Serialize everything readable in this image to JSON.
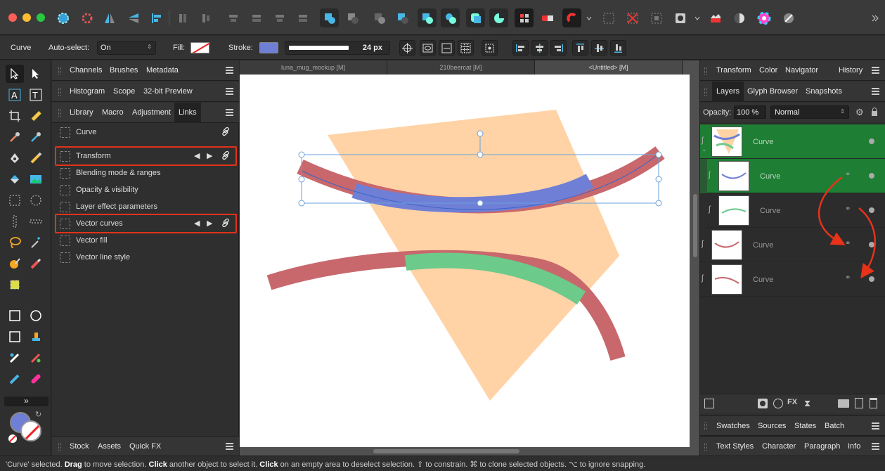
{
  "window": {
    "traffic_lights": [
      "#ff5f57",
      "#febc2e",
      "#28c840"
    ]
  },
  "context_bar": {
    "tool_name": "Curve",
    "auto_select_label": "Auto-select:",
    "auto_select_value": "On",
    "fill_label": "Fill:",
    "stroke_label": "Stroke:",
    "stroke_color": "#6f7fd6",
    "stroke_width": "24 px"
  },
  "left_panels": {
    "group1_tabs": [
      "Channels",
      "Brushes",
      "Metadata"
    ],
    "group2_tabs": [
      "Histogram",
      "Scope",
      "32-bit Preview"
    ],
    "group3_tabs": [
      "Library",
      "Macro",
      "Adjustment",
      "Links"
    ],
    "group3_active": "Links",
    "links": [
      {
        "label": "Curve",
        "highlight": false,
        "arrows": false,
        "link": true
      },
      {
        "label": "Transform",
        "highlight": true,
        "arrows": true,
        "link": true
      },
      {
        "label": "Blending mode & ranges",
        "highlight": false,
        "arrows": false,
        "link": false
      },
      {
        "label": "Opacity & visibility",
        "highlight": false,
        "arrows": false,
        "link": false
      },
      {
        "label": "Layer effect parameters",
        "highlight": false,
        "arrows": false,
        "link": false
      },
      {
        "label": "Vector curves",
        "highlight": true,
        "arrows": true,
        "link": true
      },
      {
        "label": "Vector fill",
        "highlight": false,
        "arrows": false,
        "link": false
      },
      {
        "label": "Vector line style",
        "highlight": false,
        "arrows": false,
        "link": false
      }
    ],
    "bottom_tabs": [
      "Stock",
      "Assets",
      "Quick FX"
    ]
  },
  "documents": {
    "tabs": [
      "luna_mug_mockup [M]",
      "210beercat [M]",
      "<Untitled> [M]"
    ],
    "active": "<Untitled> [M]"
  },
  "right_panels": {
    "top_tabs": [
      "Transform",
      "Color",
      "Navigator",
      "History"
    ],
    "layers_tabs": [
      "Layers",
      "Glyph Browser",
      "Snapshots"
    ],
    "opacity_label": "Opacity:",
    "opacity_value": "100 %",
    "blend_mode": "Normal",
    "layers": [
      {
        "name": "Curve",
        "selected": true,
        "child": false
      },
      {
        "name": "Curve",
        "selected": true,
        "child": true
      },
      {
        "name": "Curve",
        "selected": false,
        "child": true
      },
      {
        "name": "Curve",
        "selected": false,
        "child": false
      },
      {
        "name": "Curve",
        "selected": false,
        "child": false
      }
    ],
    "bottom_tabs_1": [
      "Swatches",
      "Sources",
      "States",
      "Batch"
    ],
    "bottom_tabs_2": [
      "Text Styles",
      "Character",
      "Paragraph",
      "Info"
    ]
  },
  "status": {
    "parts": [
      {
        "t": "'Curve' selected. ",
        "b": false
      },
      {
        "t": "Drag",
        "b": true
      },
      {
        "t": " to move selection. ",
        "b": false
      },
      {
        "t": "Click",
        "b": true
      },
      {
        "t": " another object to select it. ",
        "b": false
      },
      {
        "t": "Click",
        "b": true
      },
      {
        "t": " on an empty area to deselect selection. ⇧ to constrain. ⌘ to clone selected objects. ⌥ to ignore snapping.",
        "b": false
      }
    ]
  },
  "colors": {
    "accent_green": "#1e7e34",
    "canvas_shape": "#ffd3a6",
    "curve_red": "#c8686c",
    "curve_blue": "#6f7fd6",
    "curve_green": "#6cca8a",
    "highlight_red": "#e2321a"
  }
}
